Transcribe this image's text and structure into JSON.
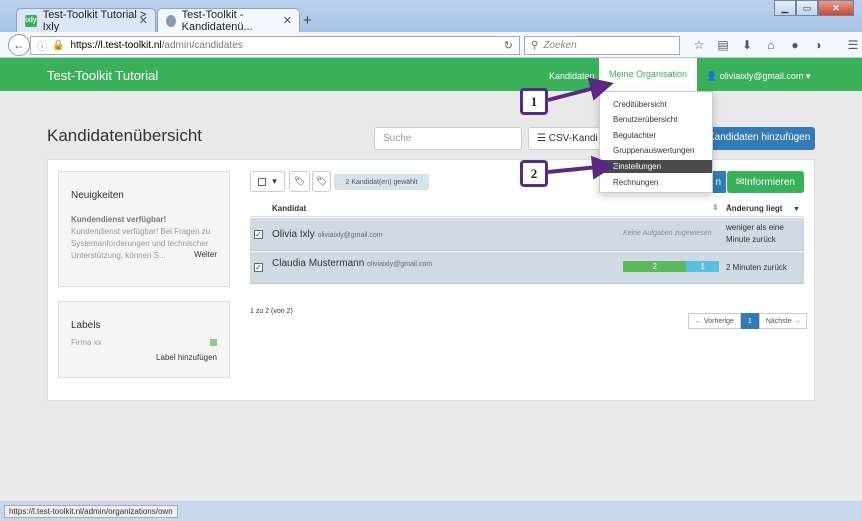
{
  "browser": {
    "tabs": [
      {
        "favicon": "ixly",
        "label": "Test-Toolkit Tutorial > Ixly",
        "active": false
      },
      {
        "favicon": "shield",
        "label": "Test-Toolkit - Kandidatenü...",
        "active": true
      }
    ],
    "new_tab": "+",
    "url_domain": "https://l.test-toolkit.nl",
    "url_path": "/admin/candidates",
    "search_placeholder": "Zoeken",
    "status_url": "https://l.test-toolkit.nl/admin/organizations/own"
  },
  "app": {
    "brand": "Test-Toolkit Tutorial",
    "accent": "#3ab05a",
    "nav": {
      "candidates": "Kandidaten",
      "my_org": "Meine Organisation",
      "user": "oliviaixly@gmail.com"
    },
    "dropdown": [
      "Creditübersicht",
      "Benutzerübersicht",
      "Begutachter",
      "Gruppenauswertungen",
      "Einstellungen",
      "Rechnungen"
    ],
    "dropdown_highlight": "Einstellungen"
  },
  "page": {
    "title": "Kandidatenübersicht",
    "search_placeholder": "Suche",
    "csv_label": "CSV-Kandi",
    "add_label": "Kandidaten hinzufügen",
    "selected_badge": "2 Kandidat(en) gewählt",
    "blue_btn_tail": "n",
    "inform_label": "Informieren"
  },
  "news": {
    "title": "Neuigkeiten",
    "headline": "Kundendienst verfügbar!",
    "text": "Kundendienst verfügbar! Bei Fragen zu Systemanforderungen und technischer Unterstützung, können S...",
    "more": "Weiter"
  },
  "labels": {
    "title": "Labels",
    "items": [
      {
        "name": "Firma xx",
        "color": "#9bc486"
      }
    ],
    "add": "Label hinzufügen"
  },
  "table": {
    "col_candidate": "Kandidat",
    "col_changed": "Änderung liegt",
    "rows": [
      {
        "name": "Olivia Ixly",
        "email": "oliviaixly@gmail.com",
        "status_text": "Keine Aufgaben zugewiesen",
        "changed": "weniger als eine Minute zurück",
        "checked": "✓"
      },
      {
        "name": "Claudia Mustermann",
        "email": "oliviaixly@gmail.com",
        "progress_done": "2",
        "progress_open": "1",
        "changed": "2 Minuten zurück",
        "checked": "✓"
      }
    ]
  },
  "pagination": {
    "info": "1 zu 2 (von 2)",
    "prev": "← Vorherige",
    "current": "1",
    "next": "Nächste →"
  },
  "callouts": [
    "1",
    "2"
  ],
  "callout_color": "#5a2a82"
}
